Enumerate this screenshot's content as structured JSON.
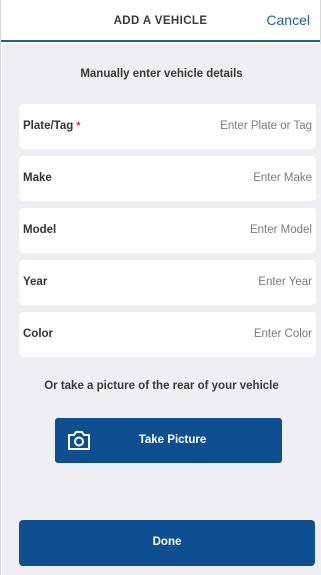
{
  "header": {
    "title": "ADD A VEHICLE",
    "cancel_label": "Cancel"
  },
  "intro_text": "Manually enter vehicle details",
  "fields": [
    {
      "label": "Plate/Tag",
      "required_mark": "*",
      "value": "",
      "placeholder": "Enter Plate or Tag"
    },
    {
      "label": "Make",
      "value": "",
      "placeholder": "Enter Make"
    },
    {
      "label": "Model",
      "value": "",
      "placeholder": "Enter Model"
    },
    {
      "label": "Year",
      "value": "",
      "placeholder": "Enter Year"
    },
    {
      "label": "Color",
      "value": "",
      "placeholder": "Enter Color"
    }
  ],
  "alt_text": "Or take a picture of the rear of your vehicle",
  "take_picture": {
    "label": "Take Picture",
    "icon": "camera-icon"
  },
  "done": {
    "label": "Done"
  },
  "colors": {
    "accent": "#1f5d9c",
    "button": "#0d4f91",
    "background": "#eeeef3",
    "required": "#d9302c"
  }
}
